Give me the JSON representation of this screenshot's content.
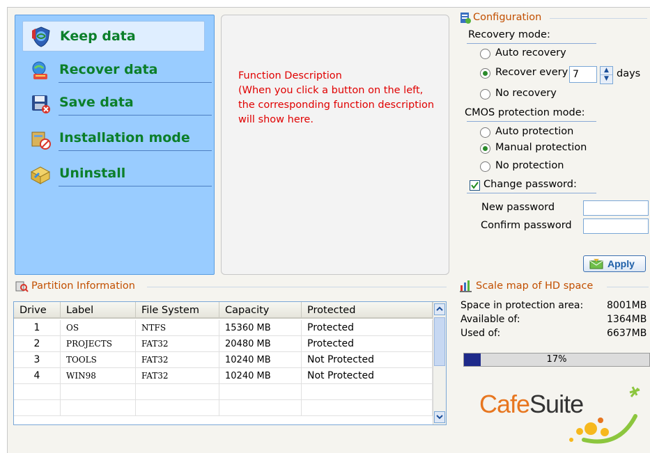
{
  "menu": {
    "items": [
      {
        "label": "Keep data",
        "icon": "shield-globe-icon",
        "active": true
      },
      {
        "label": "Recover data",
        "icon": "recover-icon"
      },
      {
        "label": "Save data",
        "icon": "save-disk-icon"
      },
      {
        "label": "Installation mode",
        "icon": "install-icon"
      },
      {
        "label": "Uninstall",
        "icon": "uninstall-icon"
      }
    ]
  },
  "description": {
    "text": "Function Description\n(When you click a button on the left, the corresponding function description will show here."
  },
  "config": {
    "title": "Configuration",
    "recovery_mode_label": "Recovery mode:",
    "recovery_options": [
      "Auto recovery",
      "Recover every",
      "No recovery"
    ],
    "recovery_selected": 1,
    "recover_days_value": "7",
    "days_label": "days",
    "cmos_label": "CMOS protection mode:",
    "cmos_options": [
      "Auto protection",
      "Manual protection",
      "No protection"
    ],
    "cmos_selected": 1,
    "change_password_label": "Change password:",
    "change_password_checked": true,
    "new_password_label": "New password",
    "confirm_password_label": "Confirm password",
    "apply_label": "Apply"
  },
  "partition": {
    "title": "Partition Information",
    "columns": [
      "Drive",
      "Label",
      "File System",
      "Capacity",
      "Protected"
    ],
    "rows": [
      [
        "1",
        "OS",
        "NTFS",
        "15360  MB",
        "Protected"
      ],
      [
        "2",
        "PROJECTS",
        "FAT32",
        "20480  MB",
        "Protected"
      ],
      [
        "3",
        "TOOLS",
        "FAT32",
        "10240  MB",
        "Not Protected"
      ],
      [
        "4",
        "WIN98",
        "FAT32",
        "10240  MB",
        "Not Protected"
      ]
    ]
  },
  "scale": {
    "title": "Scale map of HD space",
    "rows": [
      {
        "label": "Space in protection area:",
        "value": "8001MB"
      },
      {
        "label": "Available of:",
        "value": "1364MB"
      },
      {
        "label": "Used of:",
        "value": "6637MB"
      }
    ],
    "used_percent": 17,
    "used_percent_label": "17%"
  },
  "logo": {
    "part1": "Cafe",
    "part2": "Suite"
  },
  "colors": {
    "menu_bg": "#99ccff",
    "menu_text": "#0b7f2a",
    "accent_title": "#c24f00",
    "desc_text": "#e00000",
    "progress": "#1e2a8a"
  }
}
